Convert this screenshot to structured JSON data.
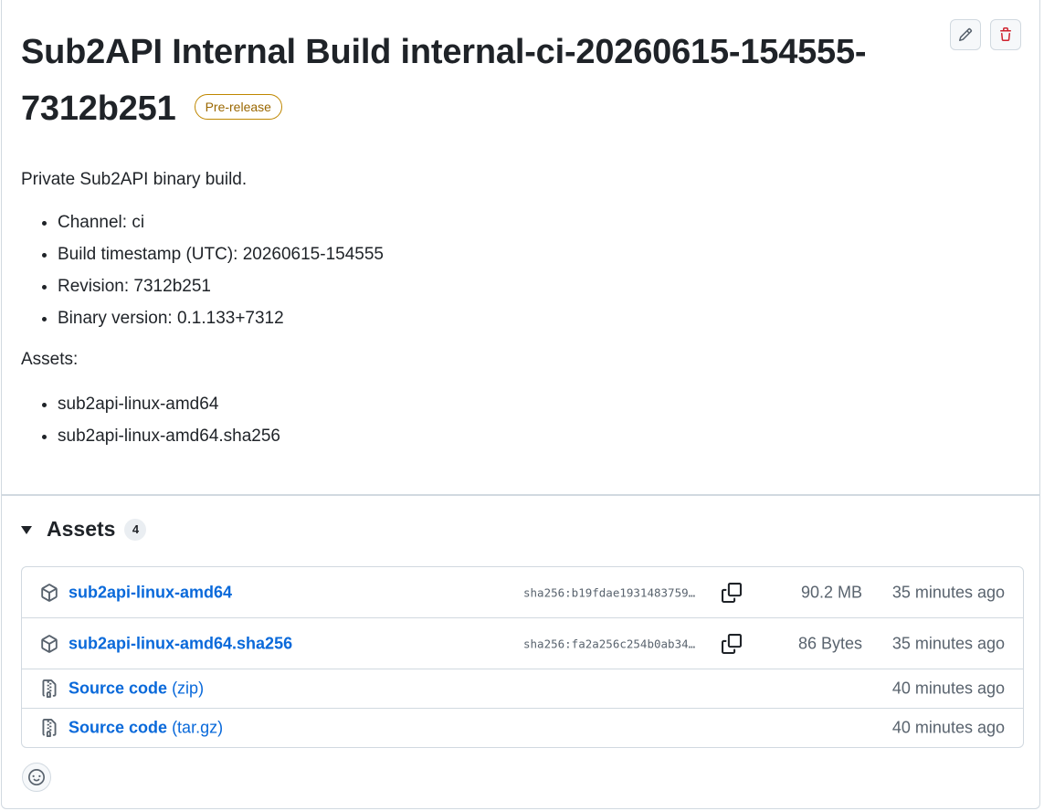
{
  "release": {
    "title": "Sub2API Internal Build internal-ci-20260615-154555-7312b251",
    "badge": "Pre-release",
    "intro": "Private Sub2API binary build.",
    "details": [
      "Channel: ci",
      "Build timestamp (UTC): 20260615-154555",
      "Revision: 7312b251",
      "Binary version: 0.1.133+7312"
    ],
    "assets_label": "Assets:",
    "asset_list": [
      "sub2api-linux-amd64",
      "sub2api-linux-amd64.sha256"
    ]
  },
  "actions": {
    "edit_icon": "pencil-icon",
    "delete_icon": "trash-icon"
  },
  "assets": {
    "title": "Assets",
    "count": "4",
    "rows": [
      {
        "icon": "package-icon",
        "name": "sub2api-linux-amd64",
        "sha": "sha256:b19fdae1931483759…",
        "size": "90.2 MB",
        "time": "35 minutes ago"
      },
      {
        "icon": "package-icon",
        "name": "sub2api-linux-amd64.sha256",
        "sha": "sha256:fa2a256c254b0ab34…",
        "size": "86 Bytes",
        "time": "35 minutes ago"
      },
      {
        "icon": "file-zip-icon",
        "name": "Source code",
        "sub": "(zip)",
        "time": "40 minutes ago"
      },
      {
        "icon": "file-zip-icon",
        "name": "Source code",
        "sub": "(tar.gz)",
        "time": "40 minutes ago"
      }
    ]
  },
  "colors": {
    "link": "#0969da",
    "prerelease": "#9a6700",
    "danger": "#cf222e",
    "border": "#d1d9e0",
    "muted": "#59636e"
  },
  "reaction_icon": "smiley-icon"
}
